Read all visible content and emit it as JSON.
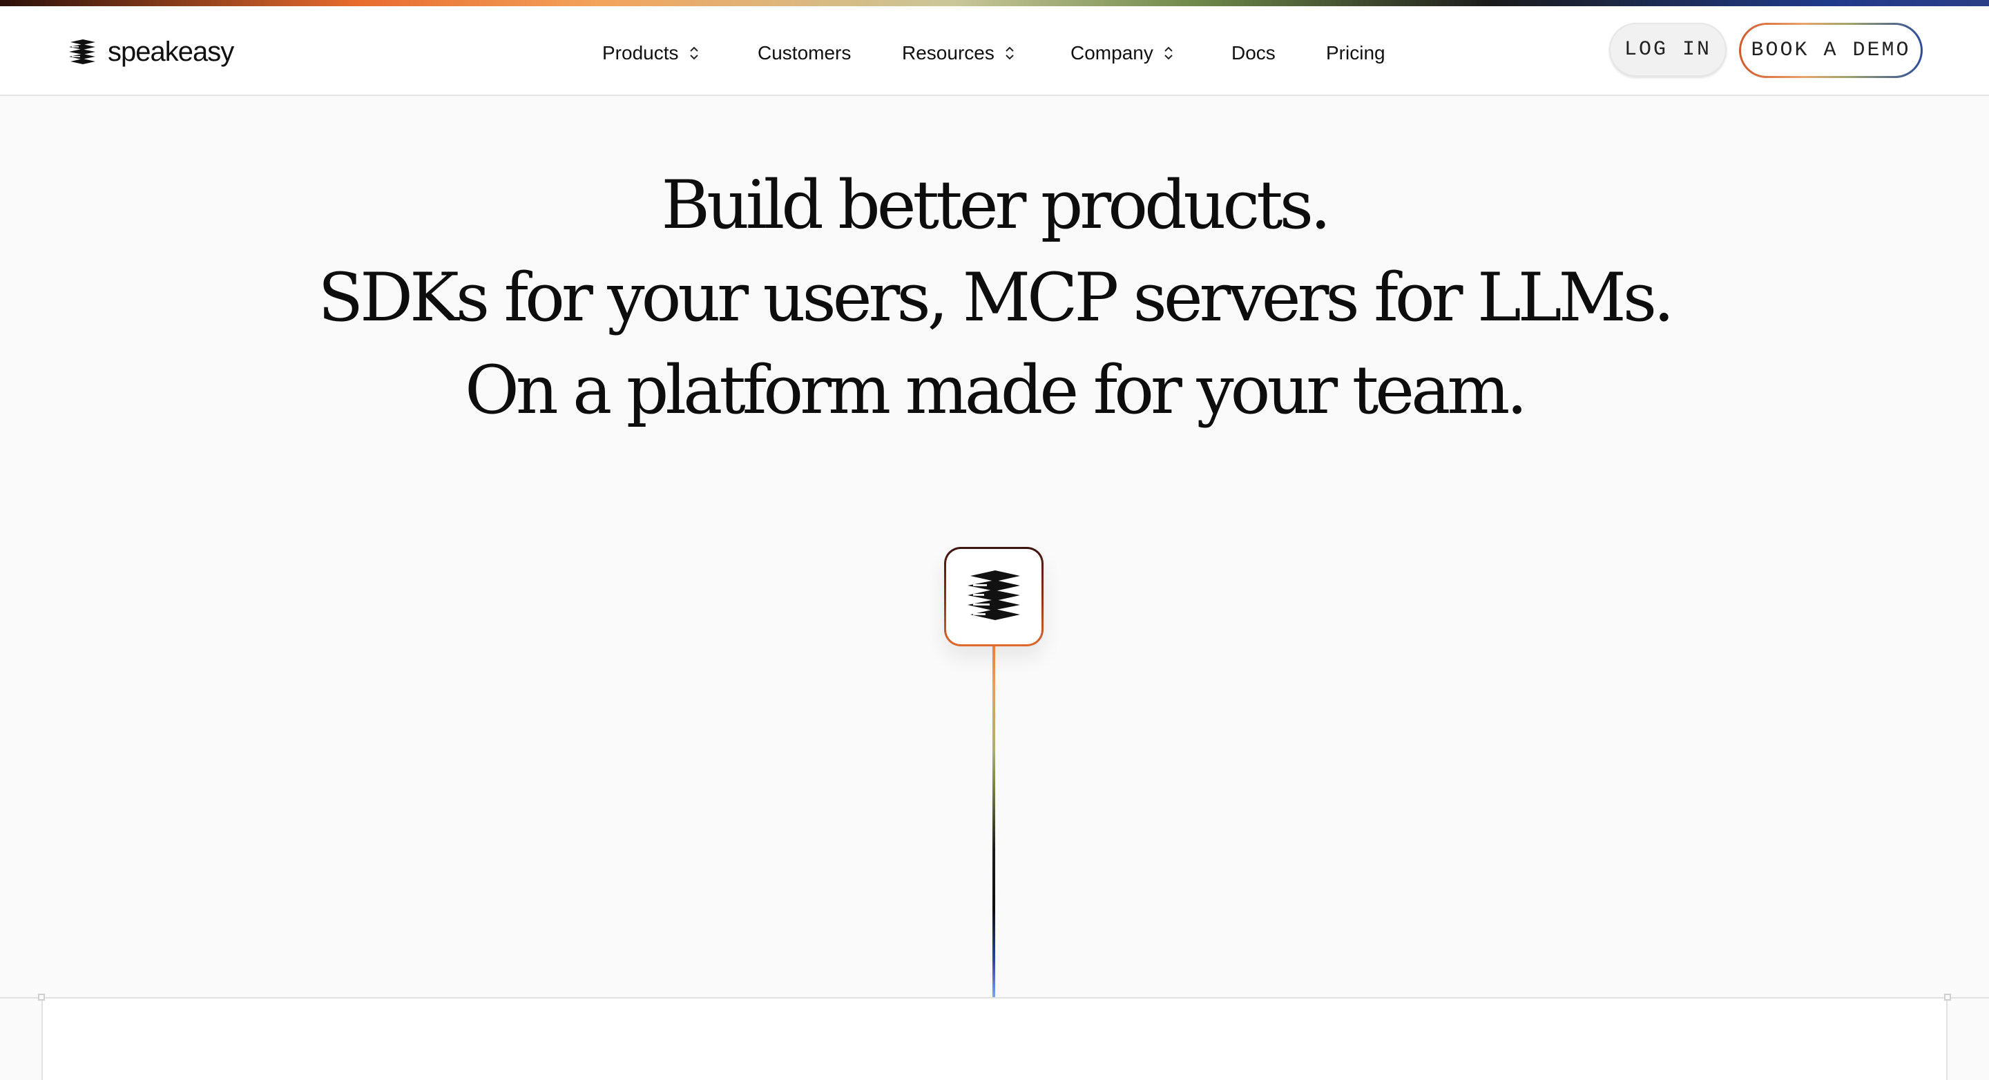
{
  "brand": {
    "name": "speakeasy",
    "logo_icon": "stacked-pages-icon"
  },
  "nav": {
    "items": [
      {
        "label": "Products",
        "has_dropdown": true
      },
      {
        "label": "Customers",
        "has_dropdown": false
      },
      {
        "label": "Resources",
        "has_dropdown": true
      },
      {
        "label": "Company",
        "has_dropdown": true
      },
      {
        "label": "Docs",
        "has_dropdown": false
      },
      {
        "label": "Pricing",
        "has_dropdown": false
      }
    ],
    "login_label": "LOG IN",
    "demo_label": "BOOK A DEMO"
  },
  "hero": {
    "line1": "Build better products.",
    "line2": "SDKs for your users, MCP servers for LLMs.",
    "line3": "On a platform made for your team."
  },
  "center_card": {
    "icon": "stacked-pages-icon"
  },
  "colors": {
    "accent_orange": "#e06a2d",
    "accent_blue": "#2d4b9a",
    "background": "#fafafa"
  }
}
